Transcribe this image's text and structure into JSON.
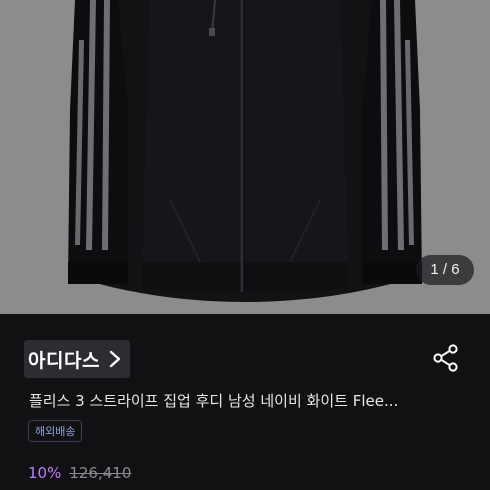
{
  "product": {
    "image_name": "black-hoodie-photo",
    "page_indicator": "1 / 6",
    "brand": "아디다스",
    "title": "플리스 3 스트라이프 집업 후디 남성 네이비 화이트 Flee...",
    "badge": "해외배송",
    "discount": "10%",
    "original_price": "126,410"
  },
  "icons": {
    "brand_chevron": "chevron-right-icon",
    "share": "share-icon"
  },
  "colors": {
    "image_background": "#8c8c8c",
    "page_background": "#111113",
    "discount": "#c07bff",
    "badge_text": "#8fa3d6"
  }
}
